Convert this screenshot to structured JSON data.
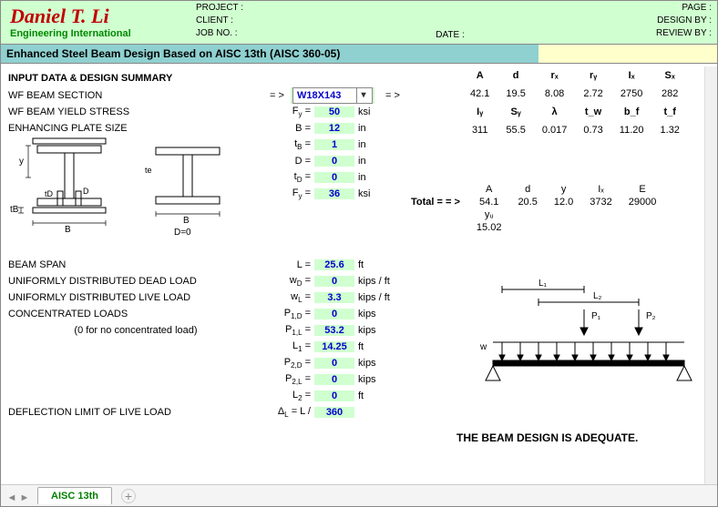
{
  "logo": {
    "name": "Daniel T. Li",
    "sub": "Engineering International"
  },
  "meta": {
    "project_lbl": "PROJECT :",
    "client_lbl": "CLIENT :",
    "job_lbl": "JOB NO. :",
    "date_lbl": "DATE :",
    "page_lbl": "PAGE :",
    "design_lbl": "DESIGN BY :",
    "review_lbl": "REVIEW BY :"
  },
  "title": "Enhanced Steel Beam Design Based on AISC 13th (AISC 360-05)",
  "section1": "INPUT DATA & DESIGN SUMMARY",
  "labels": {
    "wf_section": "WF BEAM SECTION",
    "wf_yield": "WF BEAM YIELD STRESS",
    "plate": "ENHANCING PLATE SIZE",
    "span": "BEAM SPAN",
    "dead": "UNIFORMLY DISTRIBUTED DEAD LOAD",
    "live": "UNIFORMLY DISTRIBUTED LIVE LOAD",
    "conc": "CONCENTRATED LOADS",
    "conc_note": "(0 for no concentrated load)",
    "defl": "DEFLECTION LIMIT OF LIVE LOAD"
  },
  "eq_arrow": "= >",
  "dropdown_value": "W18X143",
  "inputs": {
    "Fy": {
      "sym": "F",
      "sub": "y",
      "val": "50",
      "unit": "ksi"
    },
    "B": {
      "sym": "B",
      "val": "12",
      "unit": "in"
    },
    "tB": {
      "sym": "t",
      "sub": "B",
      "val": "1",
      "unit": "in"
    },
    "D": {
      "sym": "D",
      "val": "0",
      "unit": "in"
    },
    "tD": {
      "sym": "t",
      "sub": "D",
      "val": "0",
      "unit": "in"
    },
    "Fy2": {
      "sym": "F",
      "sub": "y",
      "val": "36",
      "unit": "ksi"
    },
    "L": {
      "sym": "L",
      "val": "25.6",
      "unit": "ft"
    },
    "wD": {
      "sym": "w",
      "sub": "D",
      "val": "0",
      "unit": "kips / ft"
    },
    "wL": {
      "sym": "w",
      "sub": "L",
      "val": "3.3",
      "unit": "kips / ft"
    },
    "P1D": {
      "sym": "P",
      "sub": "1,D",
      "val": "0",
      "unit": "kips"
    },
    "P1L": {
      "sym": "P",
      "sub": "1,L",
      "val": "53.2",
      "unit": "kips"
    },
    "L1": {
      "sym": "L",
      "sub": "1",
      "val": "14.25",
      "unit": "ft"
    },
    "P2D": {
      "sym": "P",
      "sub": "2,D",
      "val": "0",
      "unit": "kips"
    },
    "P2L": {
      "sym": "P",
      "sub": "2,L",
      "val": "0",
      "unit": "kips"
    },
    "L2": {
      "sym": "L",
      "sub": "2",
      "val": "0",
      "unit": "ft"
    },
    "deltaL": {
      "sym": "Δ",
      "sub": "L",
      "prefix": "= L /",
      "val": "360"
    }
  },
  "props1": {
    "headers": [
      "A",
      "d",
      "rₓ",
      "rᵧ",
      "Iₓ",
      "Sₓ"
    ],
    "row1": [
      "42.1",
      "19.5",
      "8.08",
      "2.72",
      "2750",
      "282"
    ],
    "headers2": [
      "Iᵧ",
      "Sᵧ",
      "λ",
      "t_w",
      "b_f",
      "t_f"
    ],
    "row2": [
      "311",
      "55.5",
      "0.017",
      "0.73",
      "11.20",
      "1.32"
    ]
  },
  "total_lbl": "Total = = >",
  "total": {
    "headers": [
      "A",
      "d",
      "y",
      "Iₓ",
      "E"
    ],
    "row": [
      "54.1",
      "20.5",
      "12.0",
      "3732",
      "29000"
    ],
    "yz_lbl": "yᵤ",
    "yz_val": "15.02"
  },
  "diagram": {
    "B": "B",
    "D": "D",
    "D0": "D=0",
    "y": "y",
    "tB": "tB",
    "tD": "tD",
    "te": "te"
  },
  "beam_diag": {
    "L1": "L₁",
    "L2": "L₂",
    "P1": "P₁",
    "P2": "P₂",
    "w": "w"
  },
  "adequate": "THE BEAM DESIGN IS ADEQUATE.",
  "tab_name": "AISC 13th"
}
